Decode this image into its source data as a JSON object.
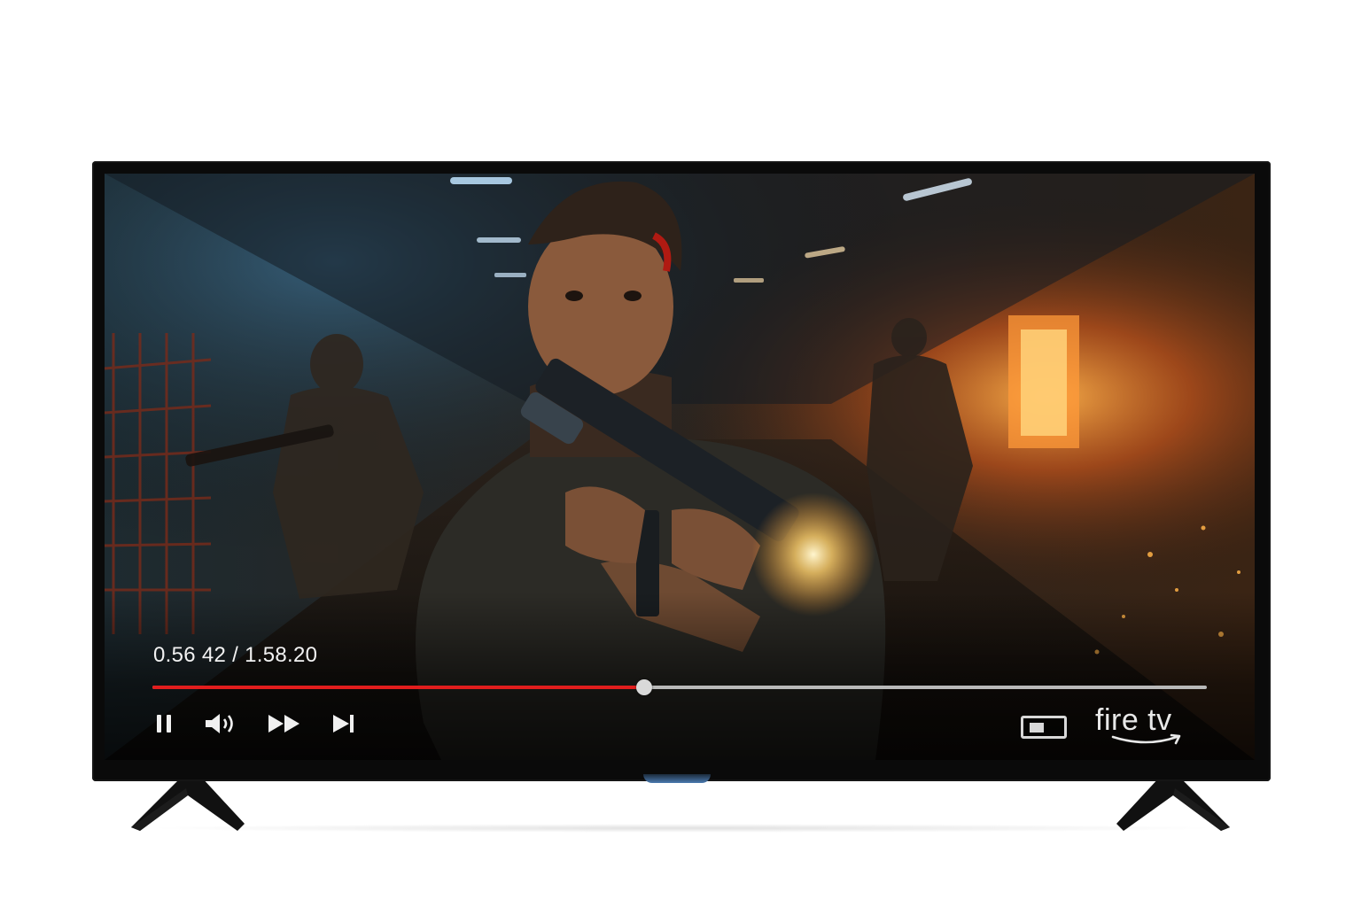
{
  "player": {
    "time_display": "0.56 42 / 1.58.20",
    "progress_fraction": 0.466,
    "accent_color": "#e11d1d",
    "track_color": "#b9b9b9"
  },
  "controls": {
    "left": [
      {
        "name": "pause-button",
        "icon": "pause-icon"
      },
      {
        "name": "volume-button",
        "icon": "volume-icon"
      },
      {
        "name": "fast-forward-button",
        "icon": "fast-forward-icon"
      },
      {
        "name": "skip-next-button",
        "icon": "skip-next-icon"
      }
    ],
    "right": [
      {
        "name": "picture-in-picture-button",
        "icon": "picture-in-picture-icon"
      }
    ]
  },
  "brand": {
    "logo_text": "fire tv"
  }
}
